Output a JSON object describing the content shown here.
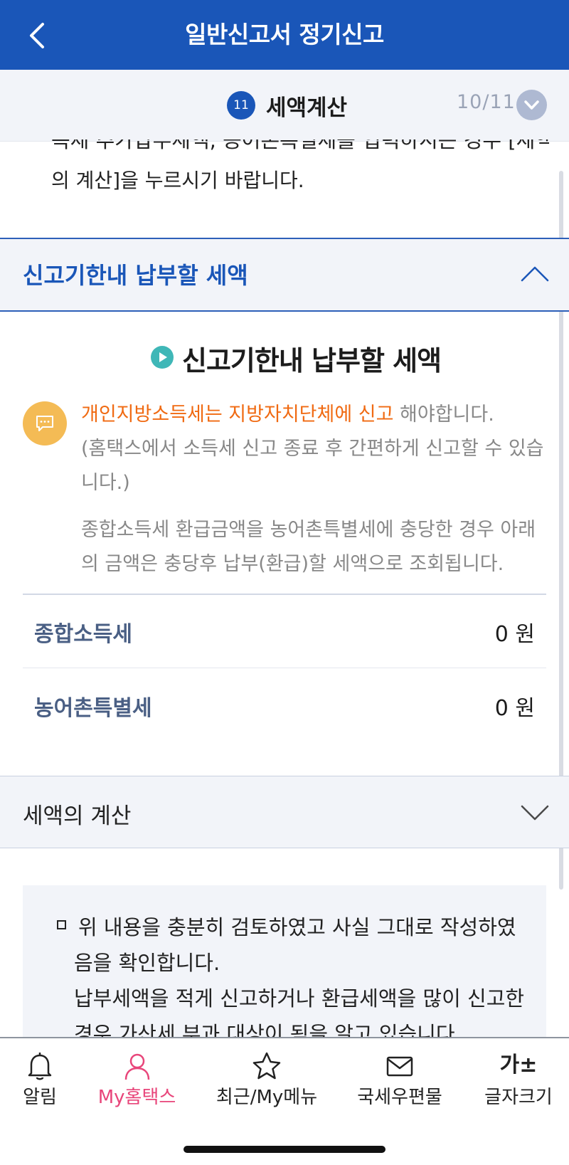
{
  "header": {
    "title": "일반신고서 정기신고"
  },
  "step": {
    "number": "11",
    "title": "세액계산",
    "count": "10/11"
  },
  "intro": {
    "clipped_line": "득세 추가납부세액, 농어촌특별세를 입력하시는 경우 [세액",
    "line2": "의 계산]을 누르시기 바랍니다."
  },
  "section_due": {
    "label": "신고기한내 납부할 세액",
    "heading": "신고기한내 납부할 세액",
    "notice": {
      "highlight": "개인지방소득세는 지방자치단체에 신고",
      "rest": " 해야합니다.",
      "line2": "(홈택스에서 소득세 신고 종료 후 간편하게 신고할 수 있습",
      "line3": "니다.)",
      "line4": "종합소득세 환급금액을 농어촌특별세에 충당한 경우 아래",
      "line5": "의 금액은 충당후 납부(환급)할 세액으로 조회됩니다."
    },
    "rows": [
      {
        "label": "종합소득세",
        "value": "0 원"
      },
      {
        "label": "농어촌특별세",
        "value": "0 원"
      }
    ]
  },
  "section_calc": {
    "label": "세액의 계산"
  },
  "confirm": {
    "line1": "위 내용을 충분히 검토하였고 사실 그대로 작성하였",
    "line2": "음을 확인합니다.",
    "line3": "납부세액을 적게 신고하거나 환급세액을 많이 신고한",
    "line4": "경우 가산세 부과 대상이 됨을 알고 있습니다."
  },
  "bottom_nav": {
    "items": [
      {
        "label": "알림",
        "icon": "bell-icon"
      },
      {
        "label": "My홈택스",
        "icon": "person-icon",
        "active": true
      },
      {
        "label": "최근/My메뉴",
        "icon": "star-icon"
      },
      {
        "label": "국세우편물",
        "icon": "envelope-icon"
      },
      {
        "label": "글자크기",
        "icon": "font-size-icon",
        "glyph": "가±"
      }
    ]
  },
  "colors": {
    "primary": "#1a56b8",
    "accent_orange": "#f06a12",
    "active_nav": "#e8457a",
    "teal": "#3fb7b7",
    "notice_yellow": "#f4bb55"
  }
}
